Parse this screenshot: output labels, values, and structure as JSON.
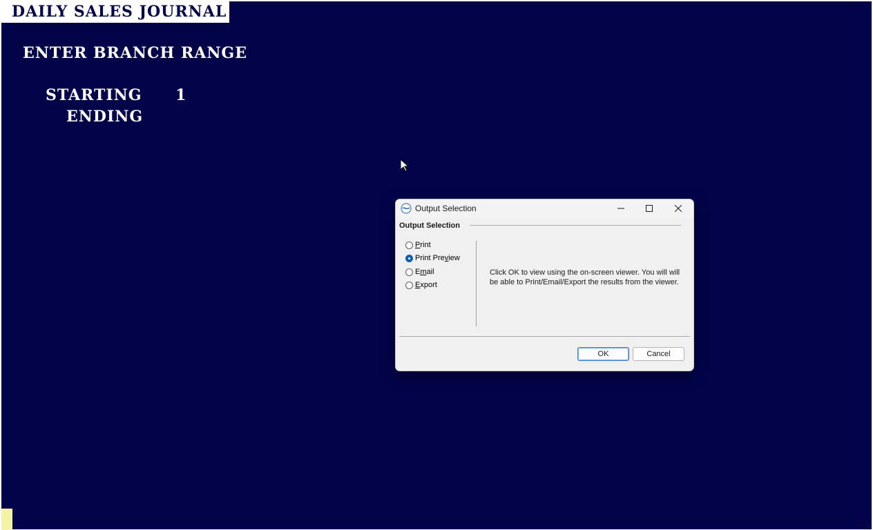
{
  "terminal": {
    "title": "DAILY SALES JOURNAL",
    "prompt": "ENTER BRANCH RANGE",
    "starting_label": "STARTING",
    "starting_value": "1",
    "ending_label": "ENDING",
    "colors": {
      "background": "#03034a",
      "text": "#ffffff",
      "cursor_block": "#f4f2a6"
    }
  },
  "dialog": {
    "window_title": "Output Selection",
    "group_header": "Output Selection",
    "options": [
      {
        "pre": "",
        "accel": "P",
        "post": "rint",
        "selected": false
      },
      {
        "pre": "Print Pre",
        "accel": "v",
        "post": "iew",
        "selected": true
      },
      {
        "pre": "E",
        "accel": "m",
        "post": "ail",
        "selected": false
      },
      {
        "pre": "",
        "accel": "E",
        "post": "xport",
        "selected": false
      }
    ],
    "info_text": "Click OK to view using the on-screen viewer.  You will will be able to Print/Email/Export the results from the viewer.",
    "ok_label": "OK",
    "cancel_label": "Cancel",
    "icons": {
      "app": "app-swirl-icon",
      "minimize": "minimize-icon",
      "maximize": "maximize-icon",
      "close": "close-icon"
    },
    "accent_color": "#0c5fb5"
  }
}
